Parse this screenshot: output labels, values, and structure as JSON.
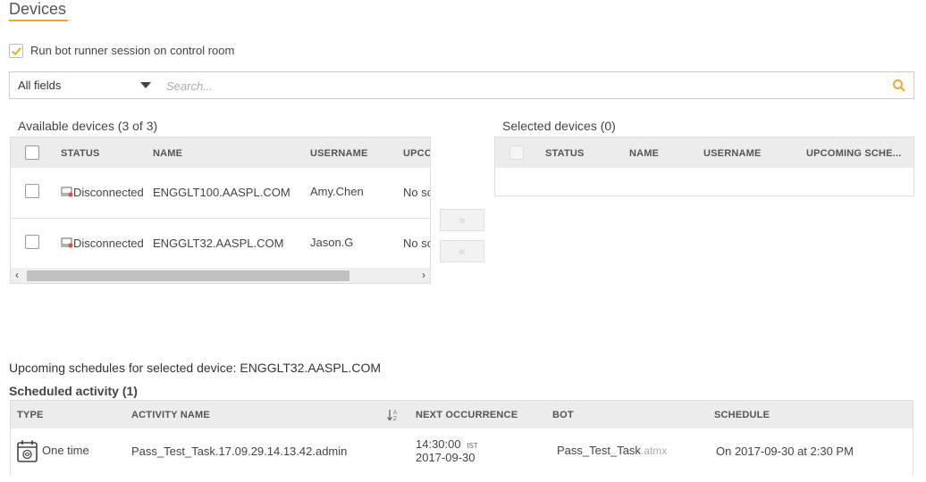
{
  "page": {
    "title": "Devices"
  },
  "run_option": {
    "label": "Run bot runner session on control room",
    "checked": true
  },
  "search": {
    "field": "All fields",
    "placeholder": "Search..."
  },
  "available": {
    "title": "Available devices (3 of 3)",
    "columns": [
      "STATUS",
      "NAME",
      "USERNAME",
      "UPCO"
    ],
    "rows": [
      {
        "status": "Disconnected",
        "name": "ENGGLT100.AASPL.COM",
        "username": "Amy.Chen",
        "upcoming": "No sc"
      },
      {
        "status": "Disconnected",
        "name": "ENGGLT32.AASPL.COM",
        "username": "Jason.G",
        "upcoming": "No sc"
      }
    ],
    "scroll_left": "‹",
    "scroll_right": "›"
  },
  "move": {
    "add": "»",
    "remove": "«"
  },
  "selected": {
    "title": "Selected devices (0)",
    "columns": [
      "STATUS",
      "NAME",
      "USERNAME",
      "UPCOMING SCHE..."
    ]
  },
  "upcoming": {
    "label": "Upcoming schedules for selected device: ENGGLT32.AASPL.COM",
    "scheduled_title": "Scheduled activity (1)",
    "columns": {
      "type": "TYPE",
      "activity": "ACTIVITY NAME",
      "next": "NEXT OCCURRENCE",
      "bot": "BOT",
      "schedule": "SCHEDULE"
    },
    "sort_icon": "sort-az-icon",
    "row": {
      "type": "One time",
      "activity": "Pass_Test_Task.17.09.29.14.13.42.admin",
      "next_time": "14:30:00",
      "next_tz": "IST",
      "next_date": "2017-09-30",
      "bot_name": "Pass_Test_Task",
      "bot_ext": ".atmx",
      "schedule": "On 2017-09-30 at 2:30 PM"
    }
  },
  "colors": {
    "accent": "#f5a623",
    "disconnected": "#d9534f"
  }
}
